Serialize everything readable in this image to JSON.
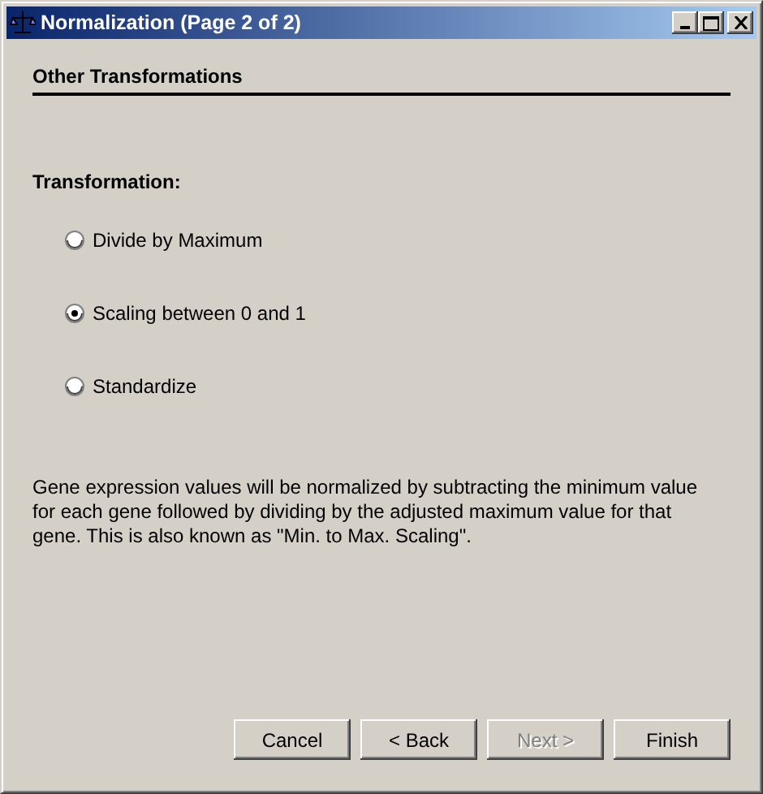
{
  "window": {
    "title": "Normalization (Page 2 of 2)"
  },
  "section": {
    "title": "Other Transformations"
  },
  "group": {
    "label": "Transformation:"
  },
  "options": [
    {
      "label": "Divide by Maximum",
      "selected": false
    },
    {
      "label": "Scaling between 0 and 1",
      "selected": true
    },
    {
      "label": "Standardize",
      "selected": false
    }
  ],
  "description": "Gene expression values will be normalized by subtracting the minimum value for each gene followed by dividing by the adjusted maximum  value for that gene. This is also known as \"Min. to Max. Scaling\".",
  "buttons": [
    {
      "label": "Cancel",
      "disabled": false
    },
    {
      "label": "< Back",
      "disabled": false
    },
    {
      "label": "Next >",
      "disabled": true
    },
    {
      "label": "Finish",
      "disabled": false
    }
  ]
}
